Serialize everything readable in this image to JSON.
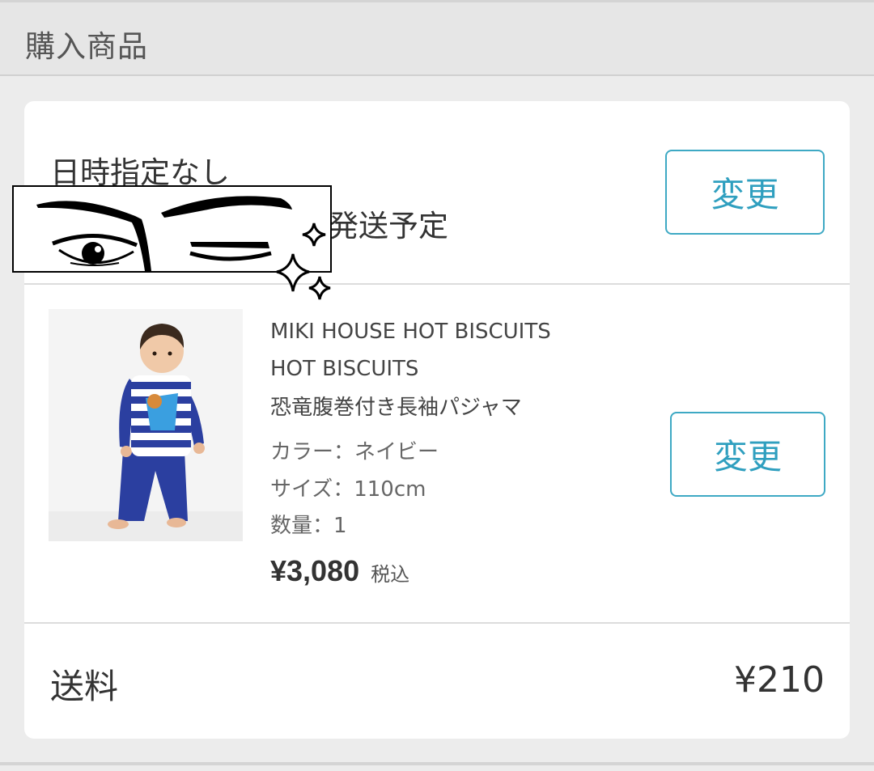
{
  "header": {
    "title": "購入商品"
  },
  "delivery": {
    "line1": "日時指定なし",
    "line2_visible": "発送予定",
    "change_label": "変更"
  },
  "item": {
    "brand_line1": "MIKI HOUSE HOT BISCUITS",
    "brand_line2": "HOT BISCUITS",
    "name": "恐竜腹巻付き長袖パジャマ",
    "color": "カラー：ネイビー",
    "size": "サイズ：110cm",
    "quantity": "数量：1",
    "price": "¥3,080",
    "tax_note": "税込",
    "change_label": "変更"
  },
  "shipping": {
    "label": "送料",
    "value": "¥210"
  },
  "colors": {
    "accent": "#2f9fbf",
    "background": "#ececec",
    "card": "#ffffff"
  }
}
